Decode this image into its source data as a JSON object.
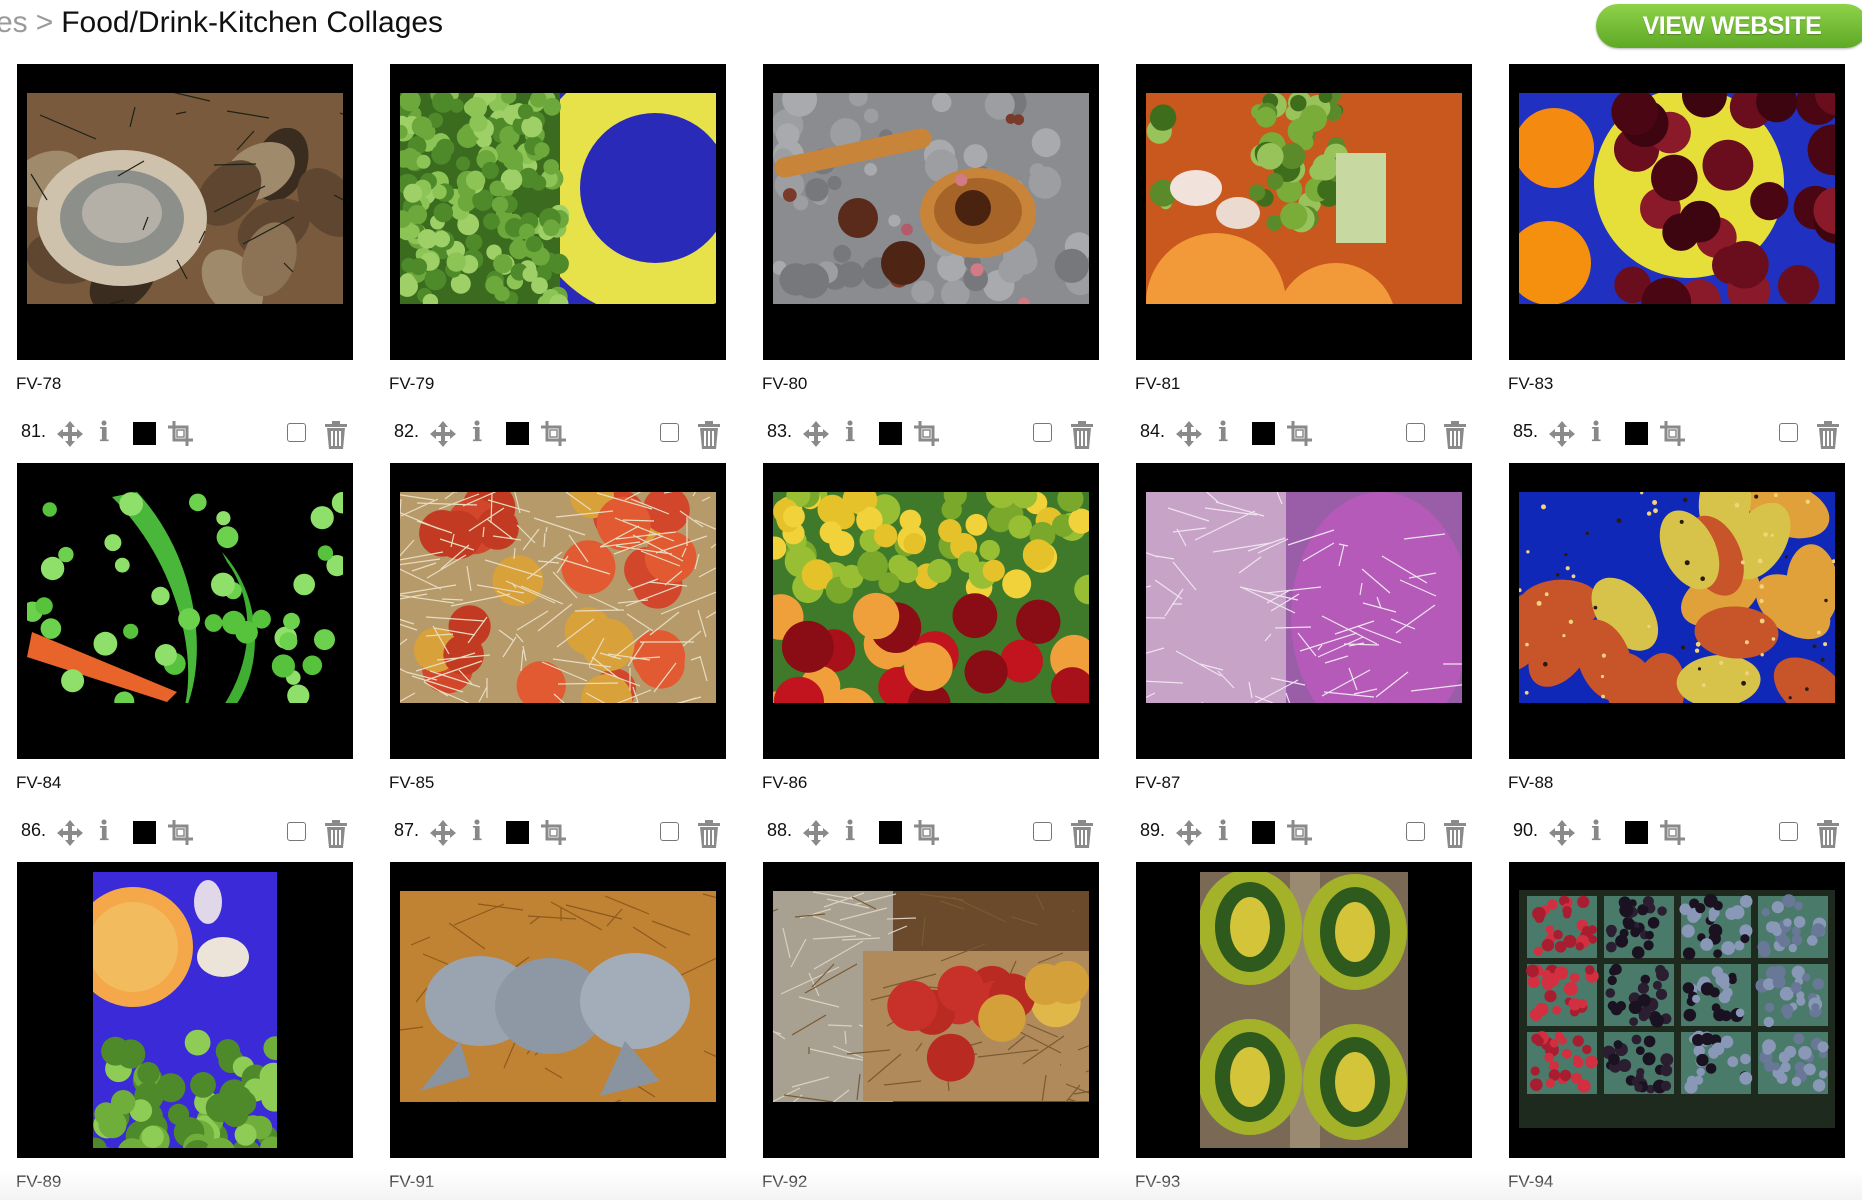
{
  "breadcrumb": {
    "previous": "es",
    "separator": ">",
    "current": "Food/Drink-Kitchen Collages"
  },
  "view_website_label": "VIEW WEBSITE",
  "cards": [
    {
      "caption": "FV-78",
      "number": "",
      "subject": "oysters"
    },
    {
      "caption": "FV-79",
      "number": "",
      "subject": "peas"
    },
    {
      "caption": "FV-80",
      "number": "",
      "subject": "star anise spoon"
    },
    {
      "caption": "FV-81",
      "number": "",
      "subject": "broccoli"
    },
    {
      "caption": "FV-83",
      "number": "",
      "subject": "cherries"
    },
    {
      "caption": "FV-84",
      "number": "81.",
      "subject": "snap peas"
    },
    {
      "caption": "FV-85",
      "number": "82.",
      "subject": "apples in straw"
    },
    {
      "caption": "FV-86",
      "number": "83.",
      "subject": "citrus and apples"
    },
    {
      "caption": "FV-87",
      "number": "84.",
      "subject": "radicchio"
    },
    {
      "caption": "FV-88",
      "number": "85.",
      "subject": "prickly pears"
    },
    {
      "caption": "FV-89",
      "number": "86.",
      "subject": "sweet potato broccoli"
    },
    {
      "caption": "FV-91",
      "number": "87.",
      "subject": "pomfret fish"
    },
    {
      "caption": "FV-92",
      "number": "88.",
      "subject": "apple basket"
    },
    {
      "caption": "FV-93",
      "number": "89.",
      "subject": "squash"
    },
    {
      "caption": "FV-94",
      "number": "90.",
      "subject": "berries"
    }
  ],
  "icons": {
    "move": "move-arrows-icon",
    "info": "info-icon",
    "color": "black-square-icon",
    "crop": "crop-icon",
    "select": "checkbox",
    "delete": "trash-icon"
  },
  "colors": {
    "button_green": "#6cb52f",
    "frame": "#000000"
  }
}
